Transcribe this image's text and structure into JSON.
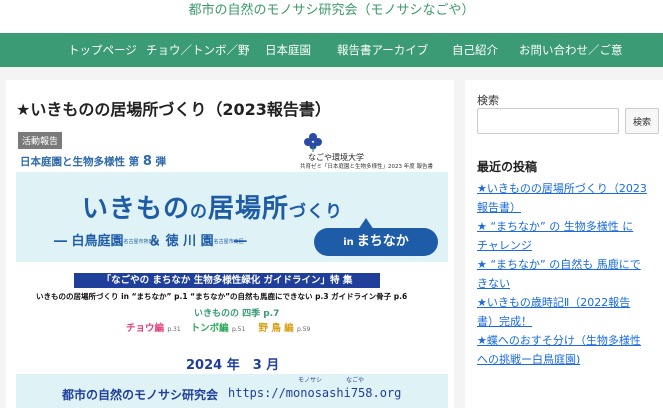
{
  "site": {
    "title": "都市の自然のモノサシ研究会（モノサシなごや）"
  },
  "nav": {
    "items": [
      "トップページ",
      "チョウ／トンボ／野",
      "日本庭園",
      "報告書アーカイブ",
      "自己紹介",
      "お問い合わせ／ご意"
    ]
  },
  "colors": {
    "nav_bg": "#3a9b74",
    "site_title": "#3c9a6a",
    "link": "#1a6be0",
    "cover_blue": "#1f5ca8"
  },
  "post": {
    "title": "★いきものの居場所づくり（2023報告書）",
    "cover": {
      "category": "活動報告",
      "series": "日本庭園と生物多様性 第",
      "series_num": "8",
      "series_suffix": "弾",
      "university": "なごや環境大学",
      "university_sub": "共育ゼミ「日本庭園と生物多様性」2023 年度 報告書",
      "main_title_a": "いきもの",
      "main_title_no": "の",
      "main_title_b": "居場所",
      "main_title_zukuri": "づくり",
      "subtitle_a": "― 白鳥庭園",
      "subtitle_a_note": "名古屋市熱田区",
      "subtitle_amp": "＆",
      "subtitle_b": "徳 川 園",
      "subtitle_b_note": "名古屋市東区",
      "subtitle_end": "―",
      "bubble_in": "in",
      "bubble_text": "まちなか",
      "guide_box": "「なごやの まちなか 生物多様性緑化 ガイドライン」特 集",
      "toc_line1": "いきものの居場所づくり in “まちなか”  p.1    “まちなか”の自然も馬鹿にできない  p.3    ガイドライン骨子  p.6",
      "toc_line2": "いきものの 四季  p.7",
      "toc_butterfly": "チョウ編",
      "toc_butterfly_page": "p.31",
      "toc_dragonfly": "トンボ編",
      "toc_dragonfly_page": "p.51",
      "toc_bird": "野 鳥 編",
      "toc_bird_page": "p.59",
      "date": "2024 年　3 月",
      "org": "都市の自然のモノサシ研究会",
      "url": "https://monosashi758.org",
      "ruby_monosashi": "モノサシ",
      "ruby_nagoya": "なごや"
    }
  },
  "sidebar": {
    "search_label": "検索",
    "search_placeholder": "",
    "search_button": "検索",
    "recent_heading": "最近の投稿",
    "recent_posts": [
      "★いきものの居場所づくり（2023",
      "報告書）",
      "★ “まちなか” の 生物多様性 に",
      "チャレンジ",
      "★ “まちなか” の自然も 馬鹿にで",
      "きない",
      "★いきもの歳時記Ⅱ（2022報告",
      "書）完成！",
      "★蝶へのおすそ分け（生物多様性",
      "への挑戦ー白鳥庭園)"
    ]
  }
}
